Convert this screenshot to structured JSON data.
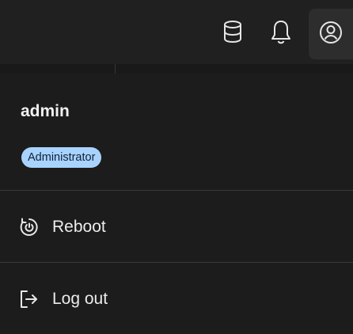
{
  "header": {
    "icons": {
      "database": "database-icon",
      "notifications": "bell-icon",
      "account": "account-circle-icon"
    }
  },
  "user_menu": {
    "username": "admin",
    "role_badge": "Administrator",
    "items": [
      {
        "label": "Reboot",
        "icon": "restart-icon"
      },
      {
        "label": "Log out",
        "icon": "logout-icon"
      }
    ]
  },
  "colors": {
    "badge_background": "#a9d3ff",
    "badge_text": "#0f2238",
    "panel_background": "#1c1c1c",
    "topbar_background": "#202020"
  }
}
